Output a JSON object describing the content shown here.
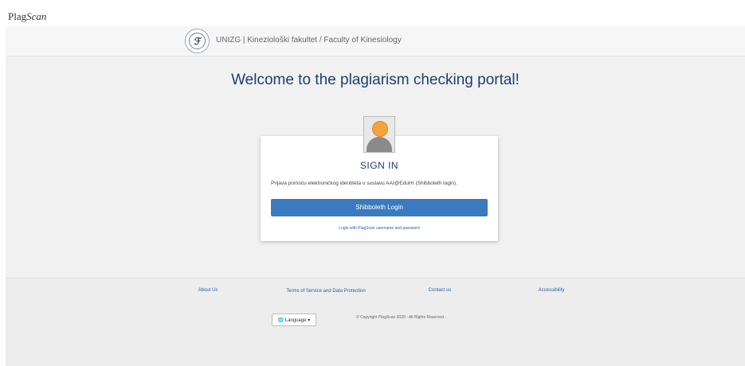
{
  "brand": {
    "logo_text_a": "Plag",
    "logo_text_b": "Scan"
  },
  "institution": {
    "name": "UNIZG | Kineziološki fakultet / Faculty of Kinesiology"
  },
  "welcome": {
    "title": "Welcome to the plagiarism checking portal!"
  },
  "signin": {
    "title": "SIGN IN",
    "description": "Prijava pomoću elektroničkog identiteta u sustavu AAI@EduHr (Shibboleth login).",
    "shibboleth_button": "Shibboleth Login",
    "alt_login": "Login with PlagScan username and password"
  },
  "footer": {
    "links": [
      "About Us",
      "Terms of Service and Data Protection",
      "Contact us",
      "Accessibility"
    ],
    "language_button": "Language",
    "copyright": "© Copyright PlagScan 2020 - All Rights Reserved -"
  },
  "colors": {
    "accent": "#3a7bbf",
    "title": "#1f3e6f",
    "link": "#2a5ea6"
  }
}
